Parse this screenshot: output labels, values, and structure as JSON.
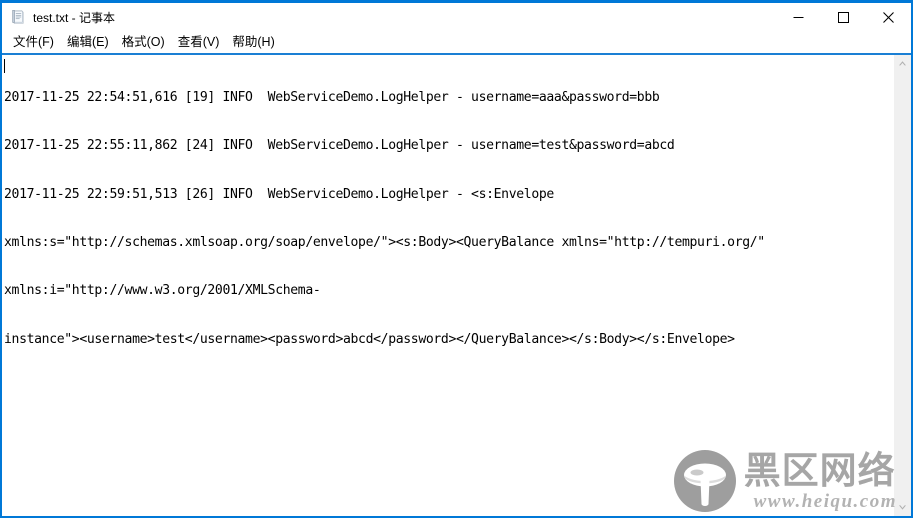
{
  "window": {
    "title": "test.txt - 记事本",
    "icon": "notepad-icon",
    "border_color": "#0078d7",
    "caption": {
      "minimize_label": "最小化",
      "maximize_label": "最大化",
      "close_label": "关闭"
    }
  },
  "menubar": {
    "items": [
      {
        "label": "文件(F)"
      },
      {
        "label": "编辑(E)"
      },
      {
        "label": "格式(O)"
      },
      {
        "label": "查看(V)"
      },
      {
        "label": "帮助(H)"
      }
    ]
  },
  "document": {
    "lines": [
      "2017-11-25 22:54:51,616 [19] INFO  WebServiceDemo.LogHelper - username=aaa&password=bbb",
      "2017-11-25 22:55:11,862 [24] INFO  WebServiceDemo.LogHelper - username=test&password=abcd",
      "2017-11-25 22:59:51,513 [26] INFO  WebServiceDemo.LogHelper - <s:Envelope",
      "xmlns:s=\"http://schemas.xmlsoap.org/soap/envelope/\"><s:Body><QueryBalance xmlns=\"http://tempuri.org/\"",
      "xmlns:i=\"http://www.w3.org/2001/XMLSchema-",
      "instance\"><username>test</username><password>abcd</password></QueryBalance></s:Body></s:Envelope>"
    ]
  },
  "scrollbar": {
    "up_label": "向上滚动",
    "down_label": "向下滚动",
    "track_color": "#f0f0f0"
  },
  "watermark": {
    "brand": "黑区网络",
    "url": "www.heiqu.com",
    "color": "#a6a6a6"
  }
}
